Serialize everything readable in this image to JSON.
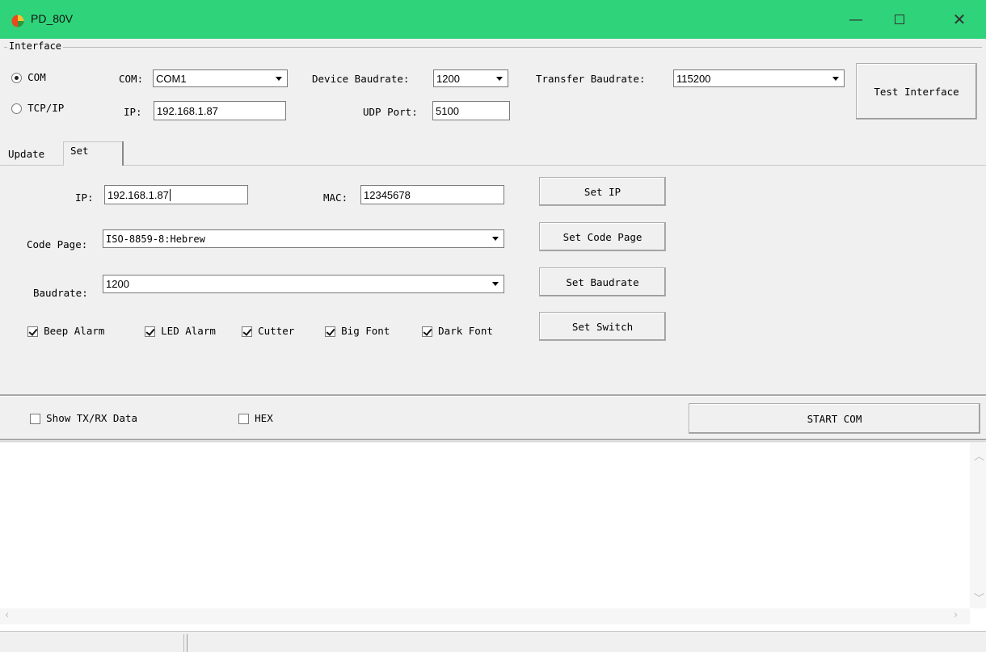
{
  "window": {
    "title": "PD_80V"
  },
  "interface": {
    "legend": "Interface",
    "radio_com": "COM",
    "radio_tcp": "TCP/IP",
    "com_label": "COM:",
    "com_value": "COM1",
    "device_baud_label": "Device Baudrate:",
    "device_baud_value": "1200",
    "transfer_baud_label": "Transfer Baudrate:",
    "transfer_baud_value": "115200",
    "test_button": "Test Interface",
    "ip_label": "IP:",
    "ip_value": "192.168.1.87",
    "udp_label": "UDP Port:",
    "udp_value": "5100"
  },
  "tabs": {
    "update": "Update",
    "set": "Set"
  },
  "set_tab": {
    "ip_label": "IP:",
    "ip_value": "192.168.1.87",
    "mac_label": "MAC:",
    "mac_value": "12345678",
    "codepage_label": "Code Page:",
    "codepage_value": "ISO-8859-8:Hebrew",
    "baudrate_label": "Baudrate:",
    "baudrate_value": "1200",
    "buttons": {
      "set_ip": "Set IP",
      "set_code_page": "Set Code Page",
      "set_baudrate": "Set Baudrate",
      "set_switch": "Set Switch"
    },
    "checks": {
      "beep_alarm": "Beep Alarm",
      "led_alarm": "LED Alarm",
      "cutter": "Cutter",
      "big_font": "Big Font",
      "dark_font": "Dark Font"
    }
  },
  "bottom": {
    "show_txrx": "Show TX/RX Data",
    "hex": "HEX",
    "start_com": "START COM"
  },
  "icons": {
    "up": "scroll-up-icon",
    "down": "scroll-down-icon",
    "left": "scroll-left-icon",
    "right": "scroll-right-icon"
  },
  "colors": {
    "titlebar": "#2fd47a"
  }
}
